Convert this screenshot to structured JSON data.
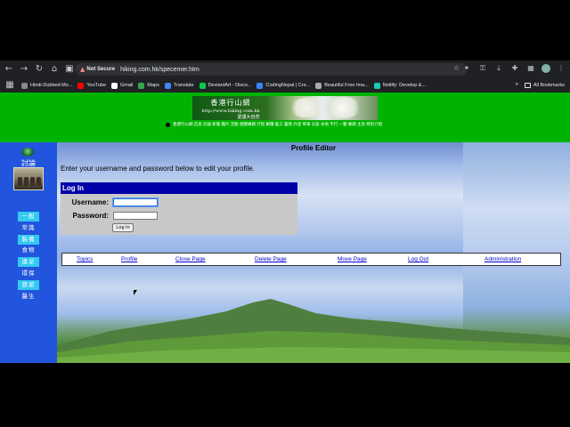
{
  "browser": {
    "security_label": "Not Secure",
    "url": "hiking.com.hk/specemer.htm",
    "bookmarks": [
      {
        "label": "Hindi-Dubbed Mo...",
        "color": "#888888"
      },
      {
        "label": "YouTube",
        "color": "#ff0000"
      },
      {
        "label": "Gmail",
        "color": "#ffffff"
      },
      {
        "label": "Maps",
        "color": "#34a853"
      },
      {
        "label": "Translate",
        "color": "#4285f4"
      },
      {
        "label": "DeviantArt - Disco...",
        "color": "#05cc47"
      },
      {
        "label": "CodingNepal | Cre...",
        "color": "#3b82f6"
      },
      {
        "label": "Beautiful Free Ima...",
        "color": "#aaaaaa"
      },
      {
        "label": "Netlify: Develop &...",
        "color": "#20c6b7"
      }
    ],
    "more_label": "»",
    "all_bookmarks": "All Bookmarks"
  },
  "header": {
    "banner_title": "香港行山網",
    "banner_url": "http://www.hiking.com.hk",
    "banner_tag": "愛護大自然",
    "menu": "香港行山網  首頁  討論  新聞  圖片  活動  相關專題  行程  郵購  義工  露營  外遊  單車  天氣  本地  不行  一覽  專題  主頁  特別介紹"
  },
  "sidebar": {
    "forum_label": "討論",
    "items": [
      {
        "label": "一般",
        "highlight": true
      },
      {
        "label": "常識",
        "highlight": false
      },
      {
        "label": "裝備",
        "highlight": true
      },
      {
        "label": "食物",
        "highlight": false
      },
      {
        "label": "遠足",
        "highlight": true
      },
      {
        "label": "環保",
        "highlight": false
      },
      {
        "label": "旅遊",
        "highlight": true
      },
      {
        "label": "醫生",
        "highlight": false
      }
    ]
  },
  "main": {
    "title": "Profile Editor",
    "instructions": "Enter your username and password below to edit your profile.",
    "login": {
      "heading": "Log In",
      "username_label": "Username:",
      "password_label": "Password:",
      "username_value": "",
      "password_value": "",
      "button_label": "Log In"
    },
    "links": [
      "Topics",
      "Profile",
      "Close Page",
      "Delete Page",
      "Move Page",
      "Log Out",
      "Administration"
    ]
  },
  "colors": {
    "header_green": "#00b300",
    "sidebar_blue": "#2255dd",
    "login_header": "#0000a8",
    "highlight_cyan": "#33c9f0",
    "link_blue": "#0000cc"
  }
}
